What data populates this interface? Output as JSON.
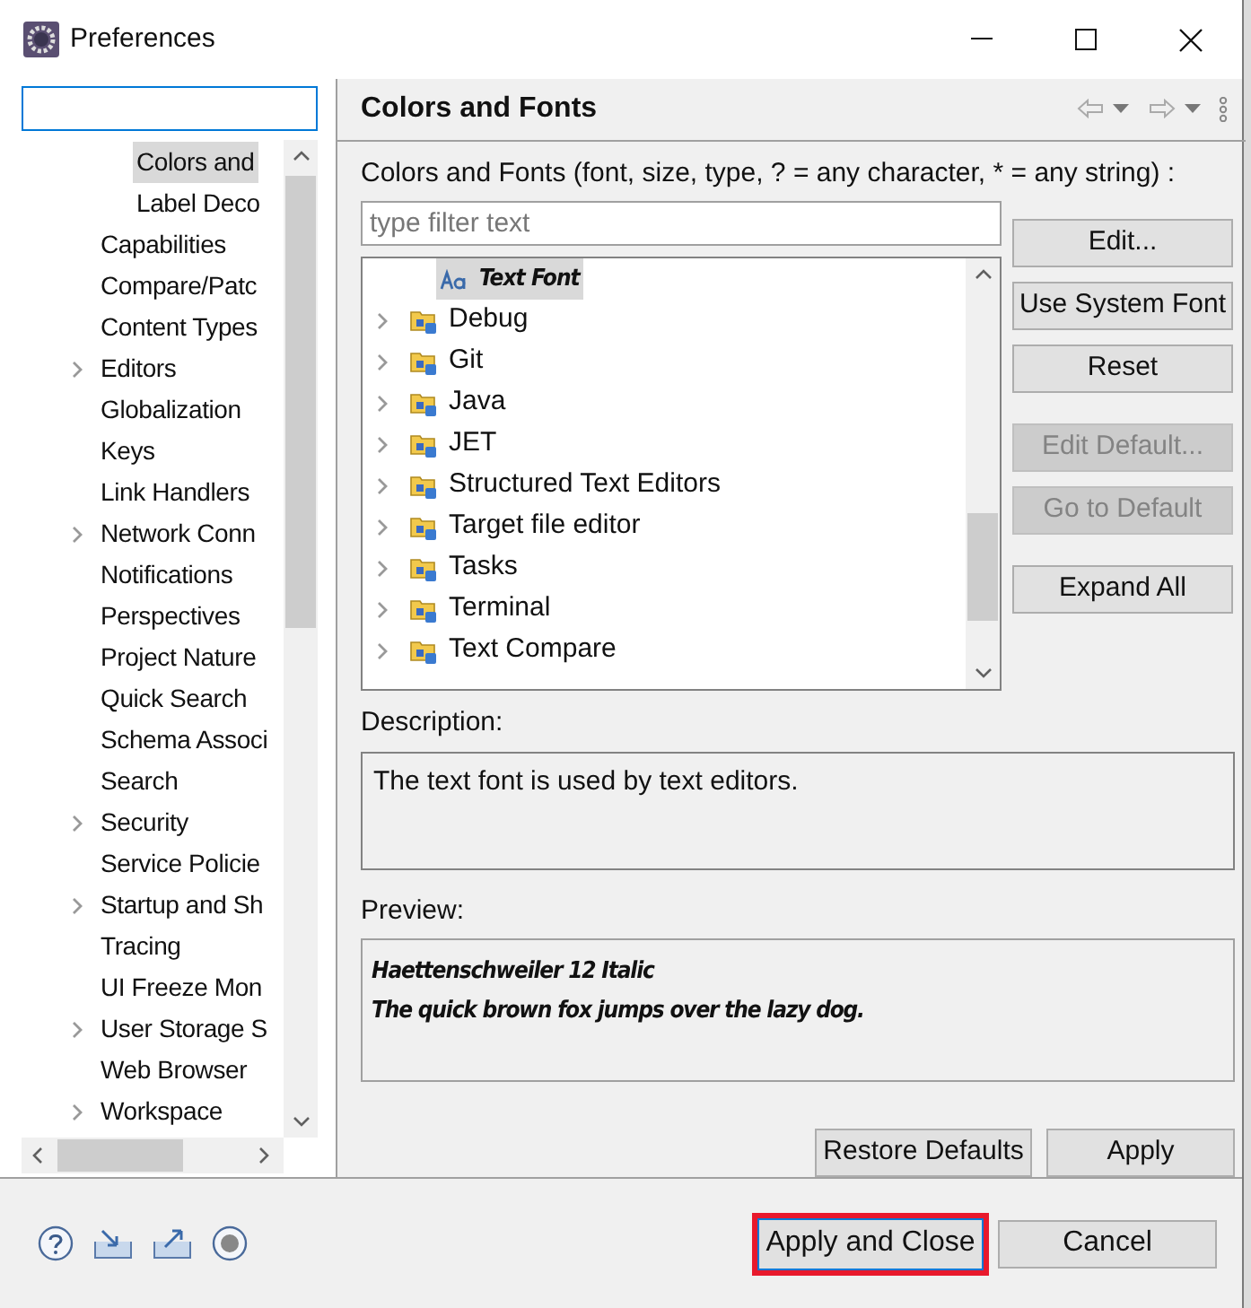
{
  "window": {
    "title": "Preferences"
  },
  "sidebar": {
    "items": [
      {
        "children": [
          {
            "label": "Colors and",
            "selected": true
          },
          {
            "label": "Label Deco",
            "selected": false
          }
        ]
      },
      {
        "label": "Capabilities",
        "expandable": false,
        "selected": false
      },
      {
        "label": "Compare/Patc",
        "expandable": false,
        "selected": false
      },
      {
        "label": "Content Types",
        "expandable": false,
        "selected": false
      },
      {
        "label": "Editors",
        "expandable": true,
        "selected": false
      },
      {
        "label": "Globalization",
        "expandable": false,
        "selected": false
      },
      {
        "label": "Keys",
        "expandable": false,
        "selected": false
      },
      {
        "label": "Link Handlers",
        "expandable": false,
        "selected": false
      },
      {
        "label": "Network Conn",
        "expandable": true,
        "selected": false
      },
      {
        "label": "Notifications",
        "expandable": false,
        "selected": false
      },
      {
        "label": "Perspectives",
        "expandable": false,
        "selected": false
      },
      {
        "label": "Project Nature",
        "expandable": false,
        "selected": false
      },
      {
        "label": "Quick Search",
        "expandable": false,
        "selected": false
      },
      {
        "label": "Schema Associ",
        "expandable": false,
        "selected": false
      },
      {
        "label": "Search",
        "expandable": false,
        "selected": false
      },
      {
        "label": "Security",
        "expandable": true,
        "selected": false
      },
      {
        "label": "Service Policie",
        "expandable": false,
        "selected": false
      },
      {
        "label": "Startup and Sh",
        "expandable": true,
        "selected": false
      },
      {
        "label": "Tracing",
        "expandable": false,
        "selected": false
      },
      {
        "label": "UI Freeze Mon",
        "expandable": false,
        "selected": false
      },
      {
        "label": "User Storage S",
        "expandable": true,
        "selected": false
      },
      {
        "label": "Web Browser",
        "expandable": false,
        "selected": false
      },
      {
        "label": "Workspace",
        "expandable": true,
        "selected": false
      }
    ]
  },
  "page": {
    "title": "Colors and Fonts",
    "filter_label": "Colors and Fonts (font, size, type, ? = any character, * = any string) :",
    "filter": {
      "placeholder": "type filter text"
    },
    "tree": [
      {
        "children": [
          {
            "label": "Text Font",
            "kind": "font",
            "selected": true
          }
        ]
      },
      {
        "label": "Debug",
        "kind": "category",
        "selected": false
      },
      {
        "label": "Git",
        "kind": "category",
        "selected": false
      },
      {
        "label": "Java",
        "kind": "category",
        "selected": false
      },
      {
        "label": "JET",
        "kind": "category",
        "selected": false
      },
      {
        "label": "Structured Text Editors",
        "kind": "category",
        "selected": false
      },
      {
        "label": "Target file editor",
        "kind": "category",
        "selected": false
      },
      {
        "label": "Tasks",
        "kind": "category",
        "selected": false
      },
      {
        "label": "Terminal",
        "kind": "category",
        "selected": false
      },
      {
        "label": "Text Compare",
        "kind": "category",
        "selected": false
      }
    ],
    "buttons": [
      {
        "label": "Edit...",
        "disabled": false
      },
      {
        "label": "Use System Font",
        "disabled": false
      },
      {
        "label": "Reset",
        "disabled": false
      },
      {
        "label": "Edit Default...",
        "disabled": true
      },
      {
        "label": "Go to Default",
        "disabled": true
      },
      {
        "label": "Expand All",
        "disabled": false
      }
    ],
    "description_label": "Description:",
    "description": "The text font is used by text editors.",
    "preview_label": "Preview:",
    "preview": [
      "Haettenschweiler 12 Italic",
      "The quick brown fox jumps over the lazy dog."
    ],
    "restore_button": "Restore Defaults",
    "apply_button": "Apply"
  },
  "footer": {
    "buttons": [
      {
        "label": "Apply and Close",
        "highlighted": true
      },
      {
        "label": "Cancel",
        "highlighted": false
      }
    ]
  }
}
